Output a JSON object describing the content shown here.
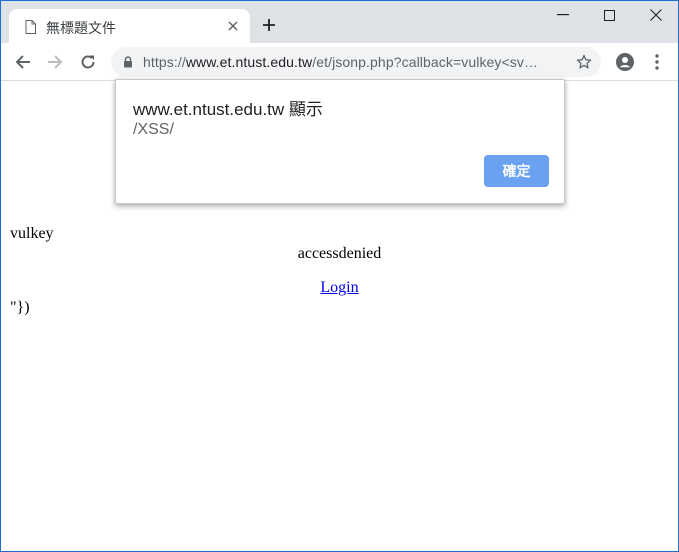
{
  "tab": {
    "title": "無標題文件",
    "icon": "document-icon"
  },
  "toolbar": {
    "url_host": "www.et.ntust.edu.tw",
    "url_prefix": "https://",
    "url_path": "/et/jsonp.php?callback=vulkey<sv…"
  },
  "dialog": {
    "title": "www.et.ntust.edu.tw 顯示",
    "message": "/XSS/",
    "ok_label": "確定"
  },
  "page": {
    "line1": "vulkey",
    "line2": "accessdenied",
    "login_link": "Login",
    "line3": "\"})"
  },
  "colors": {
    "tabstrip_bg": "#dee1e6",
    "omnibox_bg": "#f1f3f4",
    "ok_button": "#6ba1f1",
    "link": "#0000ee"
  }
}
